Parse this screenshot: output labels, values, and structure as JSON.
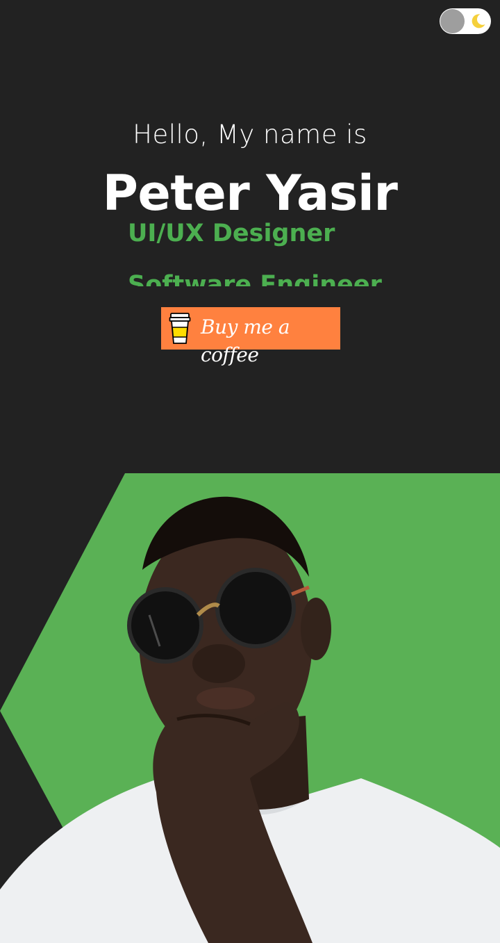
{
  "theme_toggle": {
    "state": "dark",
    "knob_icon": "toggle-knob",
    "icon": "moon-icon",
    "icon_color": "#f5d03b"
  },
  "hero": {
    "greeting": "Hello, My name is",
    "name": "Peter Yasir",
    "roles": [
      "UI/UX Designer",
      "Software Engineer"
    ],
    "accent_color": "#4caf50"
  },
  "coffee_button": {
    "label": "Buy me a coffee",
    "icon": "coffee-cup-icon",
    "background": "#ff813f"
  },
  "portrait": {
    "icon": "portrait-photo",
    "hexagon_color": "#5ab155",
    "background": "#222222"
  }
}
